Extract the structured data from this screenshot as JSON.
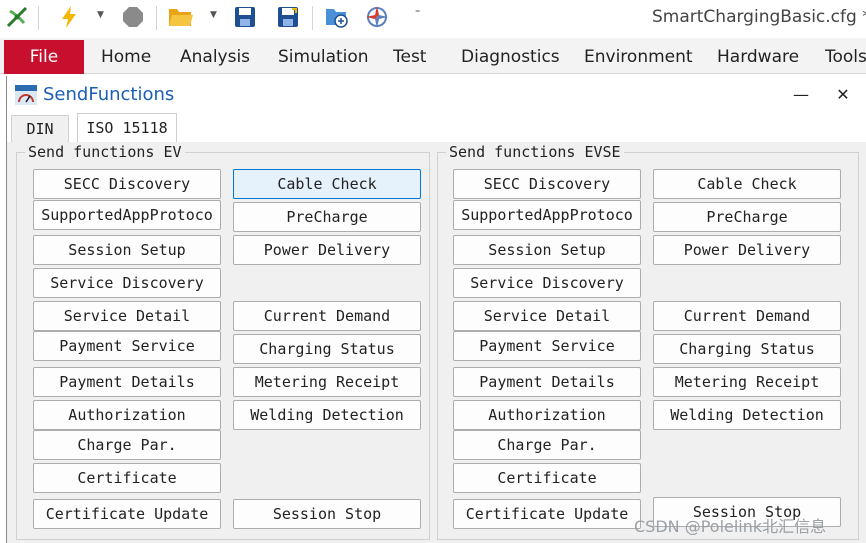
{
  "app": {
    "title": "SmartChargingBasic.cfg * ["
  },
  "toolbar": {
    "icons": [
      "app-logo-icon",
      "lightning-icon",
      "stop-icon",
      "open-folder-icon",
      "save-icon",
      "save-as-icon",
      "network-config-icon",
      "compass-config-icon"
    ]
  },
  "ribbon": {
    "tabs": [
      "File",
      "Home",
      "Analysis",
      "Simulation",
      "Test",
      "Diagnostics",
      "Environment",
      "Hardware",
      "Tools"
    ]
  },
  "window": {
    "title": "SendFunctions",
    "minimize": "—",
    "close": "✕",
    "tabs": [
      "DIN",
      "ISO 15118"
    ],
    "active_tab": "ISO 15118"
  },
  "groups": {
    "ev": {
      "label": "Send functions EV",
      "left_buttons": [
        "SECC Discovery",
        "SupportedAppProtoco",
        "Session Setup",
        "Service Discovery",
        "Service Detail",
        "Payment Service",
        "Payment Details",
        "Authorization",
        "Charge Par.",
        "Certificate",
        "Certificate Update"
      ],
      "right_buttons": [
        "Cable Check",
        "PreCharge",
        "Power Delivery",
        "Current Demand",
        "Charging Status",
        "Metering Receipt",
        "Welding Detection",
        "Session Stop"
      ]
    },
    "evse": {
      "label": "Send functions EVSE",
      "left_buttons": [
        "SECC Discovery",
        "SupportedAppProtoco",
        "Session Setup",
        "Service Discovery",
        "Service Detail",
        "Payment Service",
        "Payment Details",
        "Authorization",
        "Charge Par.",
        "Certificate",
        "Certificate Update"
      ],
      "right_buttons": [
        "Cable Check",
        "PreCharge",
        "Power Delivery",
        "Current Demand",
        "Charging Status",
        "Metering Receipt",
        "Welding Detection",
        "Session Stop"
      ]
    }
  },
  "watermark": "CSDN @Polelink北汇信息",
  "colors": {
    "file_tab": "#c8102e",
    "window_title": "#1a5fb4",
    "hover_button": "#e5f1fb",
    "hover_border": "#0078d7"
  }
}
